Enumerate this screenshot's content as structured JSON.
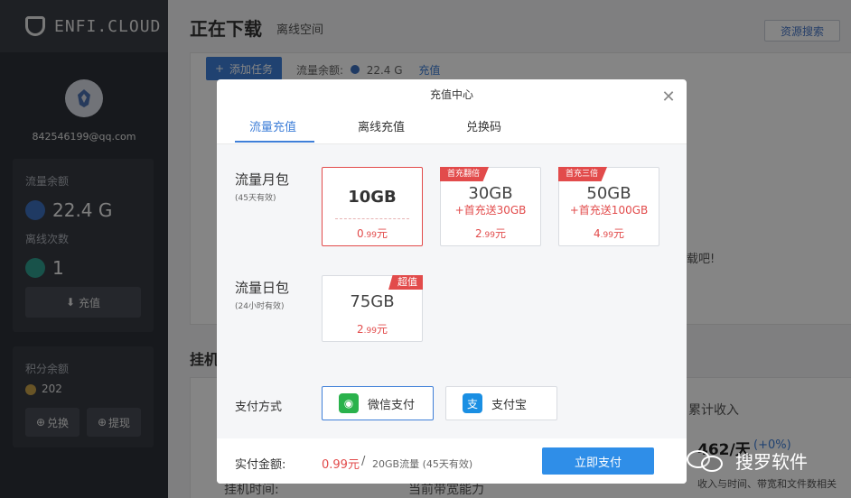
{
  "sidebar": {
    "logo_text": "ENFI.CLOUD",
    "email": "842546199@qq.com",
    "traffic_label": "流量余额",
    "traffic_value": "22.4 G",
    "offline_label": "离线次数",
    "offline_value": "1",
    "recharge_button": "充值",
    "points_label": "积分余额",
    "points_value": "202",
    "exchange_button": "兑换",
    "withdraw_button": "提现"
  },
  "main": {
    "title": "正在下载",
    "subtitle": "离线空间",
    "search_button": "资源搜索",
    "add_task_button": "添加任务",
    "quota_label": "流量余额:",
    "quota_value": "22.4 G",
    "recharge_link": "充值",
    "bg_partial_text": "载吧!",
    "section2_title": "挂机",
    "income_label": "累计收入",
    "income_value": "462/天",
    "income_change": "(+0%)",
    "bottom_text_1": "挂机时间:",
    "bottom_text_2": "当前带宽能力",
    "bottom_text_3": "收入与时间、带宽和文件数相关"
  },
  "modal": {
    "title": "充值中心",
    "tabs": [
      "流量充值",
      "离线充值",
      "兑换码"
    ],
    "monthly": {
      "title": "流量月包",
      "note": "(45天有效)",
      "packages": [
        {
          "size": "10GB",
          "bonus": "",
          "price_main": "0",
          "price_dec": ".99",
          "price_unit": "元",
          "tag": ""
        },
        {
          "size": "30GB",
          "bonus": "+首充送30GB",
          "price_main": "2",
          "price_dec": ".99",
          "price_unit": "元",
          "tag": "首充翻倍"
        },
        {
          "size": "50GB",
          "bonus": "+首充送100GB",
          "price_main": "4",
          "price_dec": ".99",
          "price_unit": "元",
          "tag": "首充三倍"
        }
      ]
    },
    "daily": {
      "title": "流量日包",
      "note": "(24小时有效)",
      "packages": [
        {
          "size": "75GB",
          "price_main": "2",
          "price_dec": ".99",
          "price_unit": "元",
          "tag": "超值"
        }
      ]
    },
    "payment": {
      "label": "支付方式",
      "wechat": "微信支付",
      "alipay": "支付宝"
    },
    "footer": {
      "amount_label": "实付金额:",
      "amount_value": "0.99元",
      "separator": "/",
      "desc": "20GB流量 (45天有效)",
      "pay_button": "立即支付"
    }
  },
  "watermark": "搜罗软件",
  "colors": {
    "accent": "#3f7fd8",
    "danger": "#e24b4b",
    "pay_button": "#2f8ee8",
    "sidebar": "#2d3138"
  }
}
